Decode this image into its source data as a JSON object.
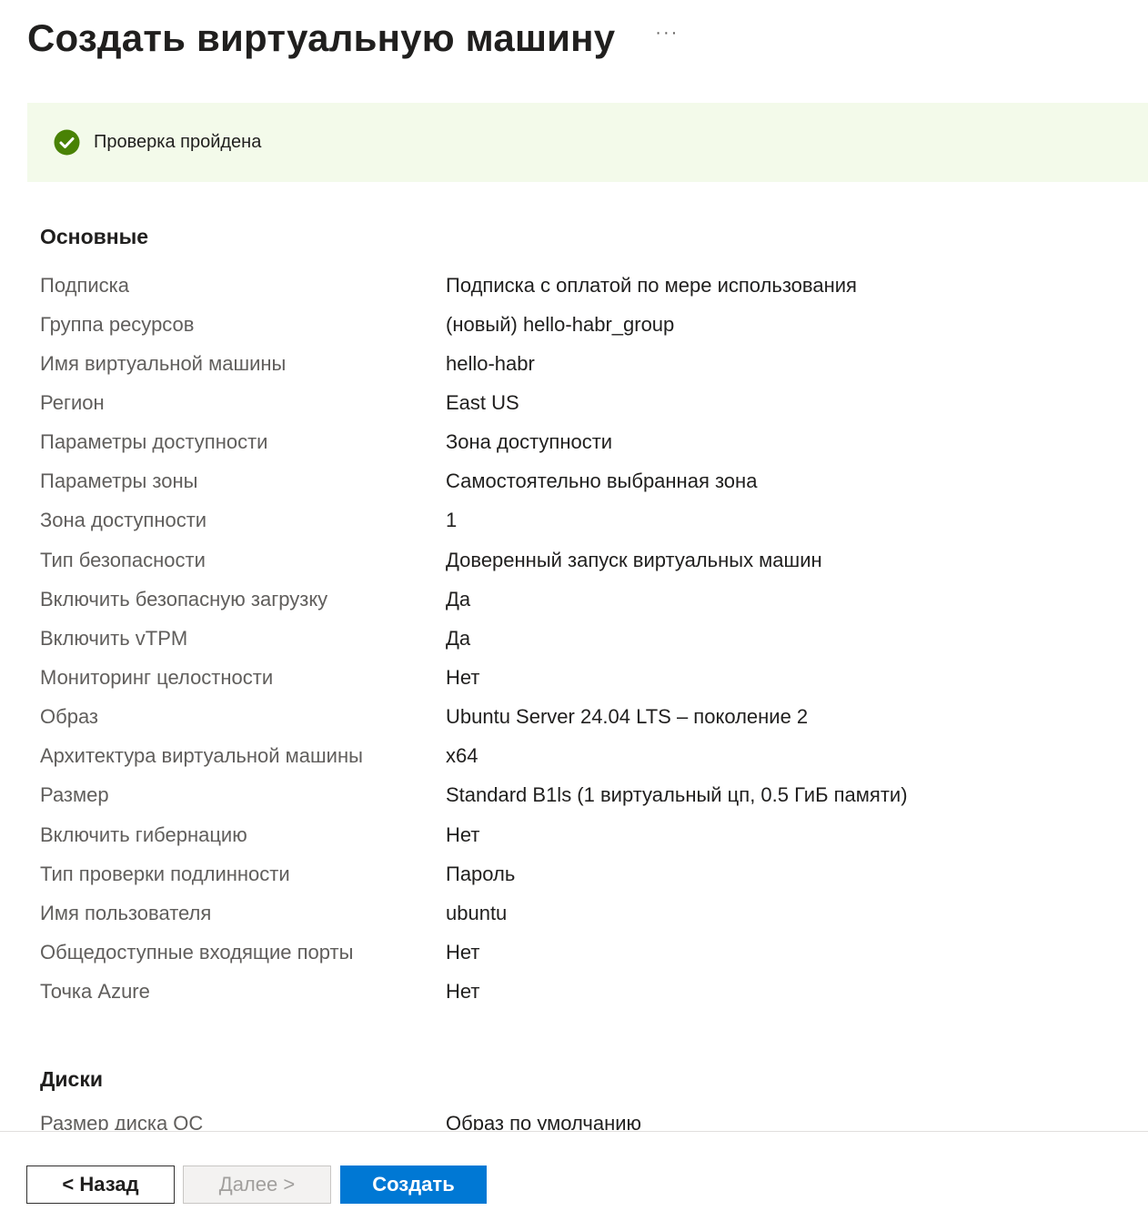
{
  "header": {
    "title": "Создать виртуальную машину",
    "more_label": "···"
  },
  "validation": {
    "icon": "check-circle-icon",
    "text": "Проверка пройдена",
    "color": "#498205"
  },
  "basics": {
    "title": "Основные",
    "rows": [
      {
        "label": "Подписка",
        "value": "Подписка с оплатой по мере использования"
      },
      {
        "label": "Группа ресурсов",
        "value": "(новый) hello-habr_group"
      },
      {
        "label": "Имя виртуальной машины",
        "value": "hello-habr"
      },
      {
        "label": "Регион",
        "value": "East US"
      },
      {
        "label": "Параметры доступности",
        "value": "Зона доступности"
      },
      {
        "label": "Параметры зоны",
        "value": "Самостоятельно выбранная зона"
      },
      {
        "label": "Зона доступности",
        "value": "1"
      },
      {
        "label": "Тип безопасности",
        "value": "Доверенный запуск виртуальных машин"
      },
      {
        "label": "Включить безопасную загрузку",
        "value": "Да"
      },
      {
        "label": "Включить vTPM",
        "value": "Да"
      },
      {
        "label": "Мониторинг целостности",
        "value": "Нет"
      },
      {
        "label": "Образ",
        "value": "Ubuntu Server 24.04 LTS – поколение 2"
      },
      {
        "label": "Архитектура виртуальной машины",
        "value": "x64"
      },
      {
        "label": "Размер",
        "value": "Standard B1ls (1 виртуальный цп, 0.5 ГиБ памяти)"
      },
      {
        "label": "Включить гибернацию",
        "value": "Нет"
      },
      {
        "label": "Тип проверки подлинности",
        "value": "Пароль"
      },
      {
        "label": "Имя пользователя",
        "value": "ubuntu"
      },
      {
        "label": "Общедоступные входящие порты",
        "value": "Нет"
      },
      {
        "label": "Точка Azure",
        "value": "Нет"
      }
    ]
  },
  "disks": {
    "title": "Диски",
    "rows": [
      {
        "label": "Размер диска ОС",
        "value": "Образ по умолчанию"
      }
    ]
  },
  "footer": {
    "back_label": "< Назад",
    "next_label": "Далее >",
    "create_label": "Создать",
    "accent_color": "#0078d4"
  }
}
